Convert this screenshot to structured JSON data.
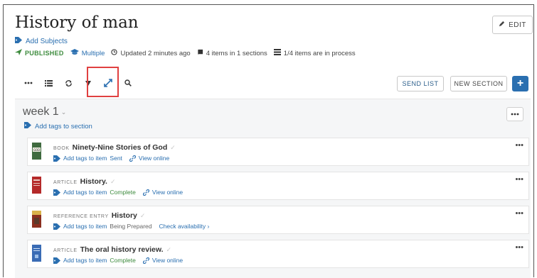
{
  "page": {
    "title": "History of man",
    "edit_label": "EDIT",
    "add_subjects_label": "Add Subjects"
  },
  "meta": {
    "published_label": "PUBLISHED",
    "multiple_label": "Multiple",
    "updated_text": "Updated 2 minutes ago",
    "items_text": "4 items in 1 sections",
    "process_text": "1/4 items are in process"
  },
  "toolbar": {
    "send_list_label": "SEND LIST",
    "new_section_label": "NEW SECTION",
    "icons": [
      "more-icon",
      "list-icon",
      "sync-icon",
      "filter-icon",
      "expand-icon",
      "search-icon"
    ]
  },
  "section": {
    "title": "week 1",
    "add_tags_label": "Add tags to section"
  },
  "items": [
    {
      "type": "BOOK",
      "name": "Ninety-Nine Stories of God",
      "add_tags": "Add tags to item",
      "status": "Sent",
      "link": "View online",
      "thumb_color": "#3f6a3f",
      "thumb_text": "GOD"
    },
    {
      "type": "ARTICLE",
      "name": "History.",
      "add_tags": "Add tags to item",
      "status": "Complete",
      "link": "View online",
      "thumb_color": "#b52a2a",
      "thumb_text": ""
    },
    {
      "type": "REFERENCE ENTRY",
      "name": "History",
      "add_tags": "Add tags to item",
      "status": "Being Prepared",
      "link": "Check availability ›",
      "thumb_color": "#8a2f1f",
      "thumb_text": ""
    },
    {
      "type": "ARTICLE",
      "name": "The oral history review.",
      "add_tags": "Add tags to item",
      "status": "Complete",
      "link": "View online",
      "thumb_color": "#3a6cb5",
      "thumb_text": ""
    }
  ],
  "colors": {
    "accent": "#2a6fb0",
    "complete": "#3d8b3d",
    "highlight": "#e04040"
  }
}
